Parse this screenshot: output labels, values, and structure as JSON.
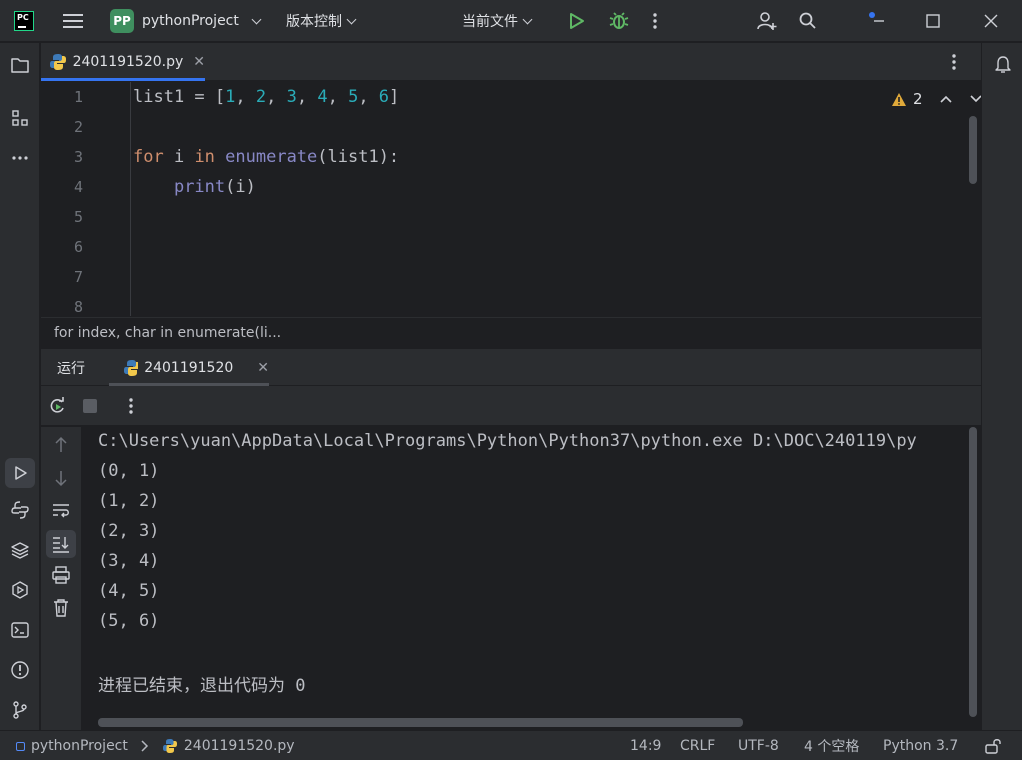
{
  "titlebar": {
    "logo_text": "PC",
    "project_badge": "PP",
    "project_name": "pythonProject",
    "vcs_label": "版本控制",
    "run_config_label": "当前文件"
  },
  "editor": {
    "tab": {
      "name": "2401191520.py"
    },
    "lines": [
      {
        "n": "1"
      },
      {
        "n": "2"
      },
      {
        "n": "3"
      },
      {
        "n": "4"
      },
      {
        "n": "5"
      },
      {
        "n": "6"
      },
      {
        "n": "7"
      },
      {
        "n": "8"
      }
    ],
    "warnings_count": "2",
    "code": {
      "l1": {
        "a": "list1 = [",
        "n1": "1",
        "n2": "2",
        "n3": "3",
        "n4": "4",
        "n5": "5",
        "n6": "6",
        "end": "]",
        "sep": ", "
      },
      "l3": {
        "kw1": "for",
        "v": " i ",
        "kw2": "in",
        "fn": " enumerate",
        "rest": "(list1):"
      },
      "l4": {
        "indent": "    ",
        "bi": "print",
        "rest": "(i)"
      }
    },
    "breadcrumb": "for index, char in enumerate(li..."
  },
  "run": {
    "title": "运行",
    "tab_label": "2401191520",
    "output": [
      "C:\\Users\\yuan\\AppData\\Local\\Programs\\Python\\Python37\\python.exe D:\\DOC\\240119\\py",
      "(0, 1)",
      "(1, 2)",
      "(2, 3)",
      "(3, 4)",
      "(4, 5)",
      "(5, 6)",
      "",
      "进程已结束，退出代码为 0"
    ]
  },
  "statusbar": {
    "project": "pythonProject",
    "file": "2401191520.py",
    "position": "14:9",
    "line_ending": "CRLF",
    "encoding": "UTF-8",
    "indent": "4 个空格",
    "interpreter": "Python 3.7"
  },
  "colors": {
    "accent": "#3574f0",
    "keyword": "#cf8e6d",
    "number": "#2aacb8",
    "builtin": "#8888c6",
    "run_green": "#5fb865",
    "warning": "#e0a93a"
  }
}
